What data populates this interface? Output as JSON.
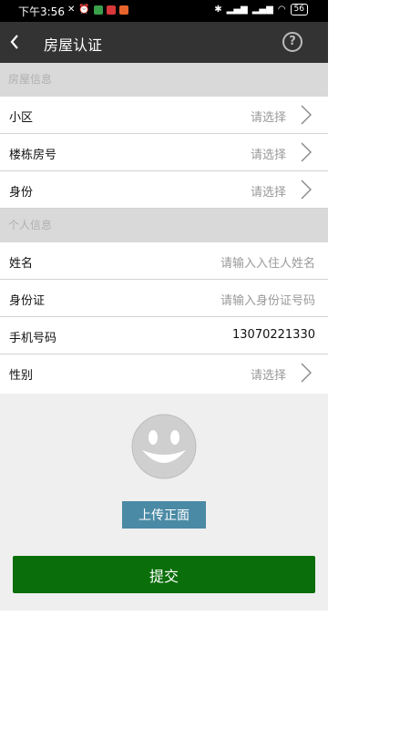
{
  "status_bar": {
    "time": "下午3:56",
    "battery": "56"
  },
  "header": {
    "title": "房屋认证"
  },
  "sections": {
    "house_info": "房屋信息",
    "personal_info": "个人信息"
  },
  "house_rows": [
    {
      "label": "小区",
      "value": "请选择"
    },
    {
      "label": "楼栋房号",
      "value": "请选择"
    },
    {
      "label": "身份",
      "value": "请选择"
    }
  ],
  "personal_rows": {
    "name": {
      "label": "姓名",
      "placeholder": "请输入入住人姓名"
    },
    "id_card": {
      "label": "身份证",
      "placeholder": "请输入身份证号码"
    },
    "phone": {
      "label": "手机号码",
      "value": "13070221330"
    },
    "gender": {
      "label": "性别",
      "value": "请选择"
    }
  },
  "upload_label": "上传正面",
  "submit_label": "提交",
  "colors": {
    "appbar": "#333333",
    "upload": "#4a8aa5",
    "submit": "#0a6e0a",
    "section": "#d9d9d9"
  },
  "icons": [
    "back-arrow-icon",
    "help-icon",
    "chevron-right-icon",
    "smiley-avatar-icon"
  ]
}
